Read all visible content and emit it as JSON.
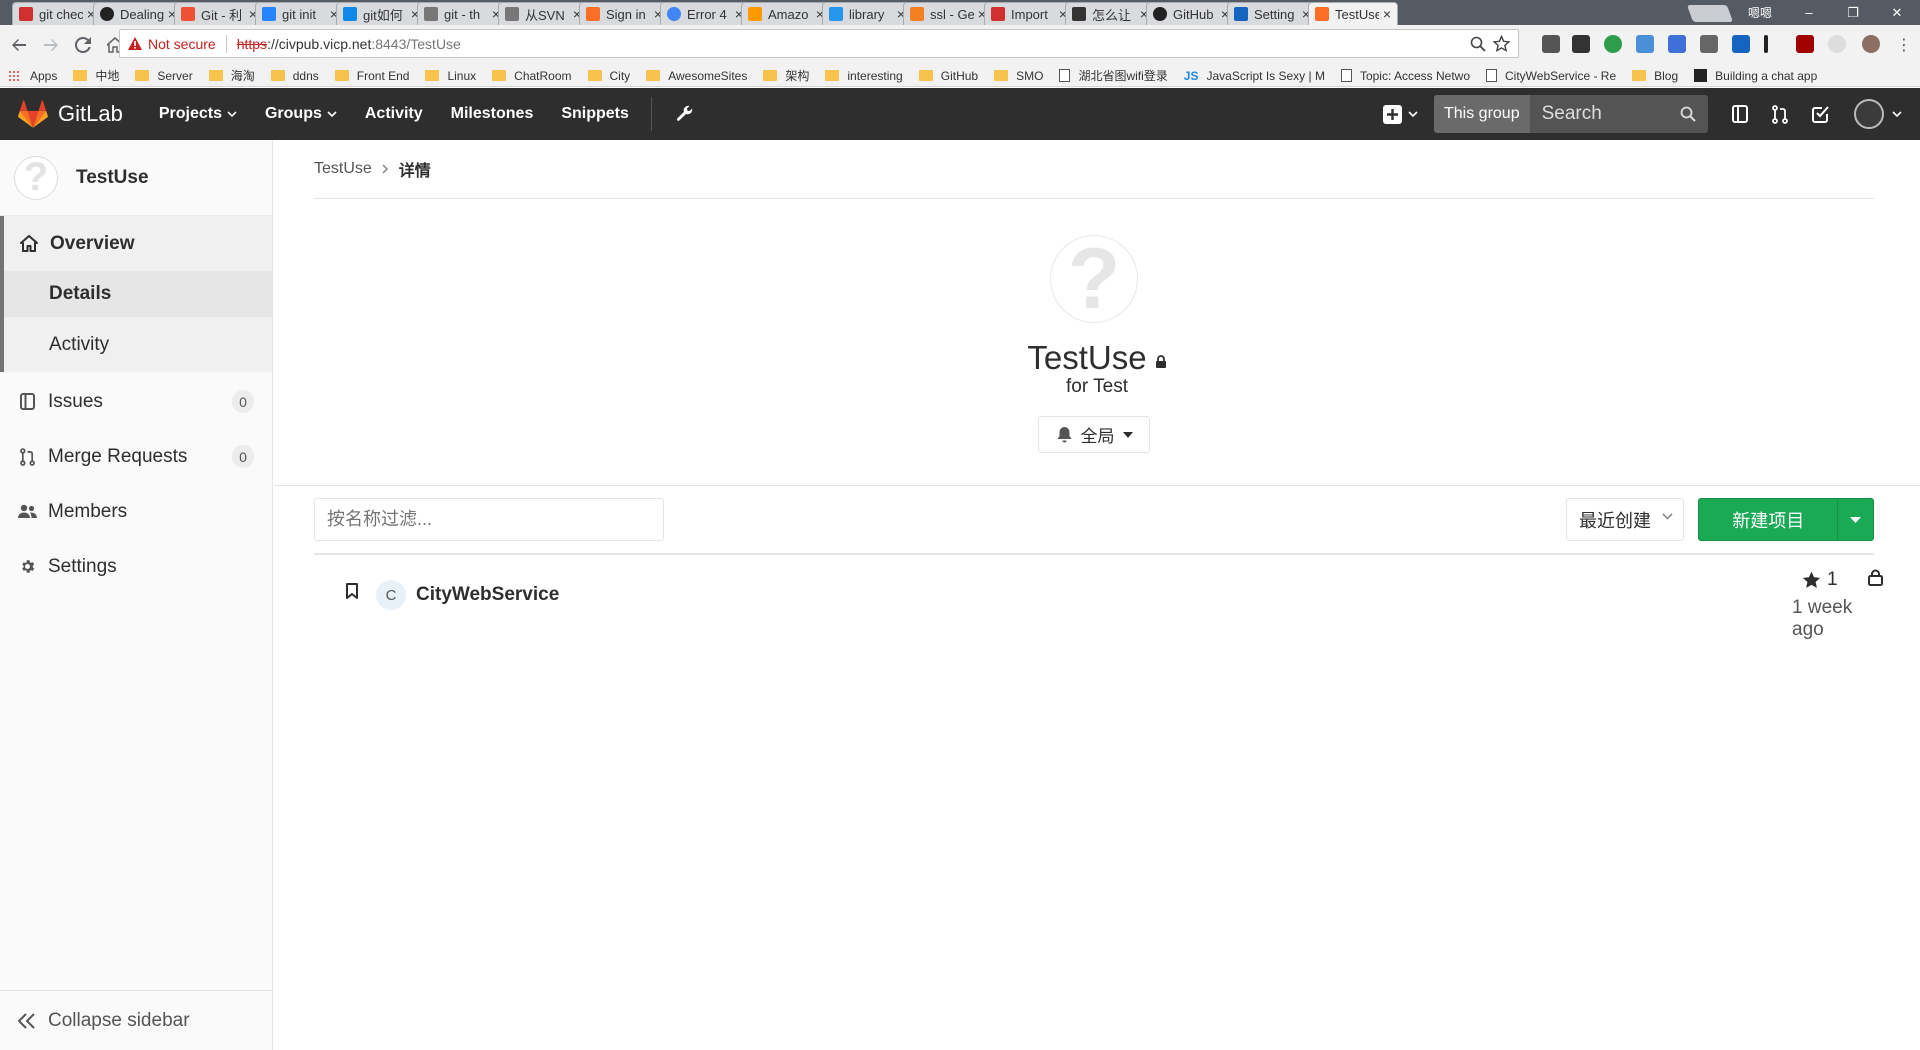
{
  "browser": {
    "tabs": [
      {
        "title": "git chec",
        "icon": "red-c-icon",
        "color": "#d32f2f"
      },
      {
        "title": "Dealing",
        "icon": "github-icon",
        "color": "#222222"
      },
      {
        "title": "Git - 利",
        "icon": "git-icon",
        "color": "#f05033"
      },
      {
        "title": "git init",
        "icon": "atlassian-icon",
        "color": "#2684ff"
      },
      {
        "title": "git如何",
        "icon": "zhihu-icon",
        "color": "#0f88eb"
      },
      {
        "title": "git - th",
        "icon": "page-icon",
        "color": "#777777"
      },
      {
        "title": "从SVN",
        "icon": "page-icon",
        "color": "#777777"
      },
      {
        "title": "Sign in",
        "icon": "gitlab-icon",
        "color": "#fc6d26"
      },
      {
        "title": "Error 4",
        "icon": "google-icon",
        "color": "#4285f4"
      },
      {
        "title": "Amazo",
        "icon": "aws-icon",
        "color": "#ff9900"
      },
      {
        "title": "library",
        "icon": "docker-icon",
        "color": "#2496ed"
      },
      {
        "title": "ssl - Ge",
        "icon": "stackoverflow-icon",
        "color": "#f48024"
      },
      {
        "title": "Import",
        "icon": "red-c-icon",
        "color": "#d32f2f"
      },
      {
        "title": "怎么让",
        "icon": "page-icon",
        "color": "#333333"
      },
      {
        "title": "GitHub",
        "icon": "github-icon",
        "color": "#222222"
      },
      {
        "title": "Setting",
        "icon": "gear-icon",
        "color": "#1565c0"
      },
      {
        "title": "TestUse",
        "icon": "gitlab-icon",
        "color": "#fc6d26",
        "active": true
      }
    ],
    "window_user": "嗯嗯",
    "address": {
      "warning": "Not secure",
      "scheme": "https",
      "host": "://civpub.vicp.net",
      "path": ":8443/TestUse"
    },
    "bookmarks": [
      {
        "label": "Apps",
        "icon": "apps-icon"
      },
      {
        "label": "中地",
        "icon": "folder-icon"
      },
      {
        "label": "Server",
        "icon": "folder-icon"
      },
      {
        "label": "海淘",
        "icon": "folder-icon"
      },
      {
        "label": "ddns",
        "icon": "folder-icon"
      },
      {
        "label": "Front End",
        "icon": "folder-icon"
      },
      {
        "label": "Linux",
        "icon": "folder-icon"
      },
      {
        "label": "ChatRoom",
        "icon": "folder-icon"
      },
      {
        "label": "City",
        "icon": "folder-icon"
      },
      {
        "label": "AwesomeSites",
        "icon": "folder-icon"
      },
      {
        "label": "架构",
        "icon": "folder-icon"
      },
      {
        "label": "interesting",
        "icon": "folder-icon"
      },
      {
        "label": "GitHub",
        "icon": "folder-icon"
      },
      {
        "label": "SMO",
        "icon": "folder-icon"
      },
      {
        "label": "湖北省图wifi登录",
        "icon": "page-icon"
      },
      {
        "label": "JavaScript Is Sexy | M",
        "icon": "js-icon"
      },
      {
        "label": "Topic: Access Netwo",
        "icon": "page-icon"
      },
      {
        "label": "CityWebService - Re",
        "icon": "page-icon"
      },
      {
        "label": "Blog",
        "icon": "folder-icon"
      },
      {
        "label": "Building a chat app",
        "icon": "grid-icon"
      }
    ]
  },
  "header": {
    "brand": "GitLab",
    "nav": {
      "projects": "Projects",
      "groups": "Groups",
      "activity": "Activity",
      "milestones": "Milestones",
      "snippets": "Snippets"
    },
    "search_scope": "This group",
    "search_placeholder": "Search"
  },
  "sidebar": {
    "group_name": "TestUse",
    "overview": "Overview",
    "details": "Details",
    "activity": "Activity",
    "issues": "Issues",
    "issues_count": "0",
    "merge_requests": "Merge Requests",
    "merge_requests_count": "0",
    "members": "Members",
    "settings": "Settings",
    "collapse": "Collapse sidebar"
  },
  "main": {
    "breadcrumb": {
      "group": "TestUse",
      "current": "详情"
    },
    "group_title": "TestUse",
    "group_description": "for Test",
    "notification_level": "全局",
    "filter_placeholder": "按名称过滤...",
    "sort_label": "最近创建",
    "new_project": "新建项目",
    "projects": [
      {
        "avatar_letter": "C",
        "name": "CityWebService",
        "stars": "1",
        "updated": "1 week ago"
      }
    ]
  },
  "colors": {
    "header_bg": "#2e2e2e",
    "new_project_green": "#1aaa55",
    "gitlab_orange": "#fc6d26"
  }
}
